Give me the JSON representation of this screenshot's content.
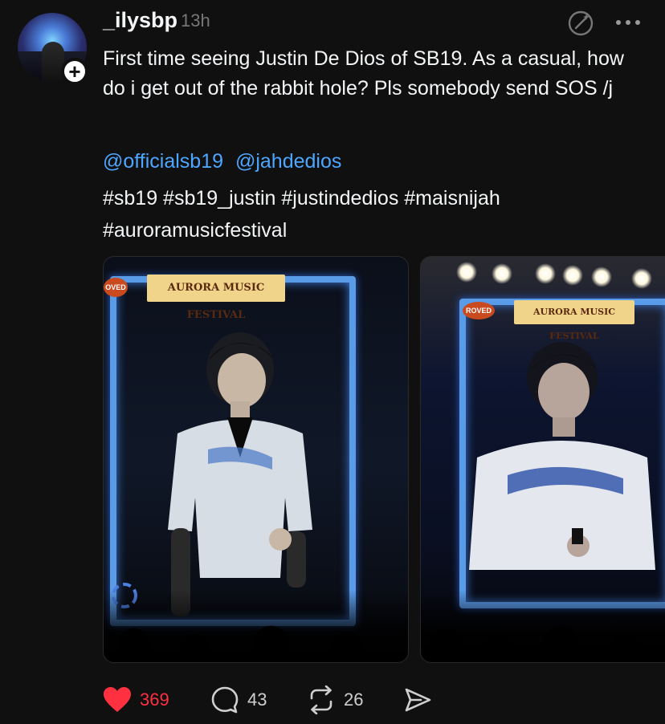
{
  "post": {
    "username": "_ilysbp",
    "time": "13h",
    "text": "First time seeing Justin De Dios of SB19. As a casual, how do i get out of the rabbit hole? Pls somebody send SOS /j",
    "mentions": [
      "@officialsb19",
      "@jahdedios"
    ],
    "hashtags": "#sb19 #sb19_justin #justindedios #maisnijah #auroramusicfestival",
    "photos": [
      {
        "banner": "AURORA MUSIC FESTIVAL",
        "stamp": "OVED"
      },
      {
        "banner": "AURORA MUSIC FESTIVAL",
        "stamp": "ROVED"
      }
    ]
  },
  "actions": {
    "likes": "369",
    "replies": "43",
    "reposts": "26"
  },
  "colors": {
    "background": "#101010",
    "like": "#ff3040",
    "mention": "#4da6ff"
  },
  "icons": [
    "plus-icon",
    "ai-sparkle-icon",
    "more-icon",
    "heart-icon",
    "comment-icon",
    "repost-icon",
    "share-icon"
  ]
}
